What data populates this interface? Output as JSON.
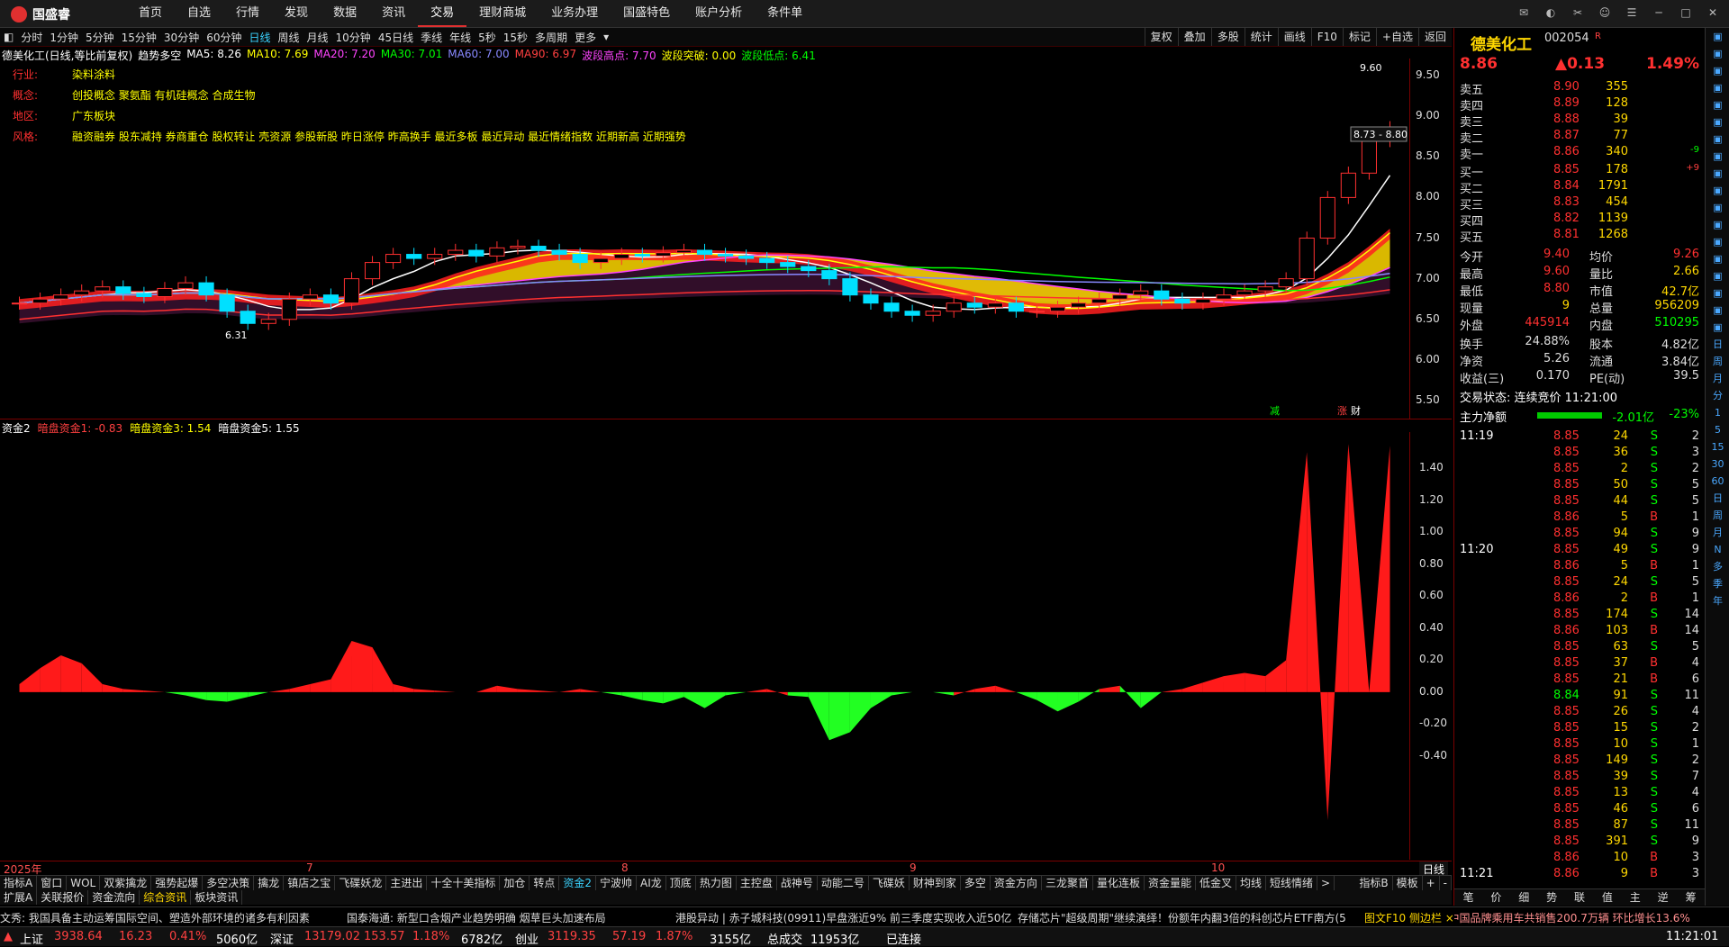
{
  "app": {
    "logo_text": "国盛睿"
  },
  "nav": [
    "首页",
    "自选",
    "行情",
    "发现",
    "数据",
    "资讯",
    "交易",
    "理财商城",
    "业务办理",
    "国盛特色",
    "账户分析",
    "条件单"
  ],
  "nav_active_index": 6,
  "periods": [
    "分时",
    "1分钟",
    "5分钟",
    "15分钟",
    "30分钟",
    "60分钟",
    "日线",
    "周线",
    "月线",
    "10分钟",
    "45日线",
    "季线",
    "年线",
    "5秒",
    "15秒",
    "多周期",
    "更多"
  ],
  "period_selected_index": 6,
  "tools": [
    "复权",
    "叠加",
    "多股",
    "统计",
    "画线",
    "F10",
    "标记",
    "+自选",
    "返回"
  ],
  "chart_header": {
    "title": "德美化工(日线,等比前复权)",
    "indicator": "趋势多空",
    "ma5": "MA5: 8.26",
    "ma10": "MA10: 7.69",
    "ma20": "MA20: 7.20",
    "ma30": "MA30: 7.01",
    "ma60": "MA60: 7.00",
    "ma90": "MA90: 6.97",
    "wave_high": "波段高点: 7.70",
    "wave_break": "波段突破: 0.00",
    "wave_low": "波段低点: 6.41"
  },
  "info": {
    "industry_label": "行业:",
    "industry": "染料涂料",
    "concept_label": "概念:",
    "concept": "创投概念 聚氨酯 有机硅概念 合成生物",
    "region_label": "地区:",
    "region": "广东板块",
    "style_label": "风格:",
    "style": "融资融券 股东减持 券商重仓 股权转让 壳资源 参股新股 昨日涨停 昨高换手 最近多板 最近异动 最近情绪指数 近期新高 近期强势"
  },
  "main_yaxis": [
    "9.50",
    "9.00",
    "8.50",
    "8.00",
    "7.50",
    "7.00",
    "6.50",
    "6.00",
    "5.50"
  ],
  "annotations": {
    "high": "9.60",
    "range": "8.73 - 8.80",
    "low": "6.31",
    "tag_reduce": "减",
    "tag_rise": "涨",
    "tag_fin": "财"
  },
  "sub_header": {
    "name": "资金2",
    "v1": "暗盘资金1: -0.83",
    "v3": "暗盘资金3: 1.54",
    "v5": "暗盘资金5: 1.55"
  },
  "sub_yaxis": [
    "1.40",
    "1.20",
    "1.00",
    "0.80",
    "0.60",
    "0.40",
    "0.20",
    "0.00",
    "-0.20",
    "-0.40"
  ],
  "dates": [
    "2025年",
    "7",
    "8",
    "9",
    "10"
  ],
  "period_label": "日线",
  "indicator_tabs": [
    "指标A",
    "窗口",
    "WOL",
    "双紫擒龙",
    "强势起爆",
    "多空决策",
    "擒龙",
    "镇店之宝",
    "飞碟妖龙",
    "主进出",
    "十全十美指标",
    "加仓",
    "转点",
    "资金2",
    "宁波帅",
    "AI龙",
    "顶底",
    "热力图",
    "主控盘",
    "战神号",
    "动能二号",
    "飞碟妖",
    "财神到家",
    "多空",
    "资金方向",
    "三龙聚首",
    "量化连板",
    "资金量能",
    "低金叉",
    "均线",
    "短线情绪"
  ],
  "indicator_selected": 13,
  "indicator_right": [
    "指标B",
    "模板",
    "+",
    "-"
  ],
  "bottom_tabs": [
    "扩展A",
    "关联报价",
    "资金流向",
    "综合资讯",
    "板块资讯"
  ],
  "bottom_tab_selected": 3,
  "ticker": [
    "文秀: 我国具备主动运筹国际空间、塑造外部环境的诸多有利因素",
    "国泰海通: 新型口含烟产业趋势明确 烟草巨头加速布局",
    "港股异动 | 赤子城科技(09911)早盘涨近9% 前三季度实现收入近50亿",
    "存储芯片\"超级周期\"继续演绎！份额年内翻3倍的科创芯片ETF南方(5",
    "中汽协: 9月中国品牌乘用车共销售200.7万辆 环比增长13.6%"
  ],
  "ticker_right": "图文F10 侧边栏 ×",
  "status": {
    "sh_label": "上证",
    "sh": "3938.64",
    "sh_chg": "16.23",
    "sh_pct": "0.41%",
    "sh_amt": "5060亿",
    "sz_label": "深证",
    "sz": "13179.02",
    "sz_chg": "153.57",
    "sz_pct": "1.18%",
    "sz_amt": "6782亿",
    "cy_label": "创业",
    "cy": "3119.35",
    "cy_chg": "57.19",
    "cy_pct": "1.87%",
    "cy_amt": "3155亿",
    "total_label": "总成交",
    "total": "11953亿",
    "conn": "已连接",
    "time": "11:21:01"
  },
  "quote": {
    "name": "德美化工",
    "code": "002054",
    "flag": "R",
    "price": "8.86",
    "change": "▲0.13",
    "pct": "1.49%",
    "asks": [
      {
        "label": "卖五",
        "price": "8.90",
        "vol": "355",
        "chg": ""
      },
      {
        "label": "卖四",
        "price": "8.89",
        "vol": "128",
        "chg": ""
      },
      {
        "label": "卖三",
        "price": "8.88",
        "vol": "39",
        "chg": ""
      },
      {
        "label": "卖二",
        "price": "8.87",
        "vol": "77",
        "chg": ""
      },
      {
        "label": "卖一",
        "price": "8.86",
        "vol": "340",
        "chg": "-9"
      }
    ],
    "bids": [
      {
        "label": "买一",
        "price": "8.85",
        "vol": "178",
        "chg": "+9"
      },
      {
        "label": "买二",
        "price": "8.84",
        "vol": "1791",
        "chg": ""
      },
      {
        "label": "买三",
        "price": "8.83",
        "vol": "454",
        "chg": ""
      },
      {
        "label": "买四",
        "price": "8.82",
        "vol": "1139",
        "chg": ""
      },
      {
        "label": "买五",
        "price": "8.81",
        "vol": "1268",
        "chg": ""
      }
    ],
    "stats": [
      {
        "l1": "今开",
        "v1": "9.40",
        "l2": "均价",
        "v2": "9.26"
      },
      {
        "l1": "最高",
        "v1": "9.60",
        "l2": "量比",
        "v2": "2.66"
      },
      {
        "l1": "最低",
        "v1": "8.80",
        "l2": "市值",
        "v2": "42.7亿"
      },
      {
        "l1": "现量",
        "v1": "9",
        "l2": "总量",
        "v2": "956209"
      },
      {
        "l1": "外盘",
        "v1": "445914",
        "l2": "内盘",
        "v2": "510295"
      }
    ],
    "stats2": [
      {
        "l1": "换手",
        "v1": "24.88%",
        "l2": "股本",
        "v2": "4.82亿"
      },
      {
        "l1": "净资",
        "v1": "5.26",
        "l2": "流通",
        "v2": "3.84亿"
      },
      {
        "l1": "收益(三)",
        "v1": "0.170",
        "l2": "PE(动)",
        "v2": "39.5"
      }
    ],
    "trade_state": "交易状态: 连续竞价 11:21:00",
    "net_label": "主力净额",
    "net_value": "-2.01亿",
    "net_pct": "-23%"
  },
  "ticks": [
    {
      "t": "11:19",
      "p": "8.85",
      "v": "24",
      "s": "S",
      "n": "2"
    },
    {
      "t": "",
      "p": "8.85",
      "v": "36",
      "s": "S",
      "n": "3"
    },
    {
      "t": "",
      "p": "8.85",
      "v": "2",
      "s": "S",
      "n": "2"
    },
    {
      "t": "",
      "p": "8.85",
      "v": "50",
      "s": "S",
      "n": "5"
    },
    {
      "t": "",
      "p": "8.85",
      "v": "44",
      "s": "S",
      "n": "5"
    },
    {
      "t": "",
      "p": "8.86",
      "v": "5",
      "s": "B",
      "n": "1"
    },
    {
      "t": "",
      "p": "8.85",
      "v": "94",
      "s": "S",
      "n": "9"
    },
    {
      "t": "11:20",
      "p": "8.85",
      "v": "49",
      "s": "S",
      "n": "9"
    },
    {
      "t": "",
      "p": "8.86",
      "v": "5",
      "s": "B",
      "n": "1"
    },
    {
      "t": "",
      "p": "8.85",
      "v": "24",
      "s": "S",
      "n": "5"
    },
    {
      "t": "",
      "p": "8.86",
      "v": "2",
      "s": "B",
      "n": "1"
    },
    {
      "t": "",
      "p": "8.85",
      "v": "174",
      "s": "S",
      "n": "14"
    },
    {
      "t": "",
      "p": "8.86",
      "v": "103",
      "s": "B",
      "n": "14"
    },
    {
      "t": "",
      "p": "8.85",
      "v": "63",
      "s": "S",
      "n": "5"
    },
    {
      "t": "",
      "p": "8.85",
      "v": "37",
      "s": "B",
      "n": "4"
    },
    {
      "t": "",
      "p": "8.85",
      "v": "21",
      "s": "B",
      "n": "6"
    },
    {
      "t": "",
      "p": "8.84",
      "v": "91",
      "s": "S",
      "n": "11"
    },
    {
      "t": "",
      "p": "8.85",
      "v": "26",
      "s": "S",
      "n": "4"
    },
    {
      "t": "",
      "p": "8.85",
      "v": "15",
      "s": "S",
      "n": "2"
    },
    {
      "t": "",
      "p": "8.85",
      "v": "10",
      "s": "S",
      "n": "1"
    },
    {
      "t": "",
      "p": "8.85",
      "v": "149",
      "s": "S",
      "n": "2"
    },
    {
      "t": "",
      "p": "8.85",
      "v": "39",
      "s": "S",
      "n": "7"
    },
    {
      "t": "",
      "p": "8.85",
      "v": "13",
      "s": "S",
      "n": "4"
    },
    {
      "t": "",
      "p": "8.85",
      "v": "46",
      "s": "S",
      "n": "6"
    },
    {
      "t": "",
      "p": "8.85",
      "v": "87",
      "s": "S",
      "n": "11"
    },
    {
      "t": "",
      "p": "8.85",
      "v": "391",
      "s": "S",
      "n": "9"
    },
    {
      "t": "",
      "p": "8.86",
      "v": "10",
      "s": "B",
      "n": "3"
    },
    {
      "t": "11:21",
      "p": "8.86",
      "v": "9",
      "s": "B",
      "n": "3"
    }
  ],
  "panel_tabs": [
    "笔",
    "价",
    "细",
    "势",
    "联",
    "值",
    "主",
    "逆",
    "筹"
  ],
  "sidebar": [
    "日",
    "周",
    "月",
    "分",
    "1",
    "5",
    "15",
    "30",
    "60",
    "日",
    "周",
    "月",
    "N",
    "多",
    "季",
    "年"
  ],
  "chart_data": {
    "type": "candlestick",
    "close": [
      6.7,
      6.75,
      6.8,
      6.85,
      6.9,
      6.82,
      6.78,
      6.88,
      6.95,
      6.8,
      6.6,
      6.45,
      6.5,
      6.75,
      6.8,
      6.7,
      7.0,
      7.2,
      7.3,
      7.25,
      7.3,
      7.35,
      7.28,
      7.38,
      7.4,
      7.35,
      7.3,
      7.2,
      7.25,
      7.3,
      7.28,
      7.32,
      7.35,
      7.3,
      7.28,
      7.25,
      7.2,
      7.15,
      7.1,
      7.0,
      6.8,
      6.7,
      6.6,
      6.55,
      6.6,
      6.7,
      6.65,
      6.7,
      6.6,
      6.6,
      6.65,
      6.7,
      6.75,
      6.8,
      6.85,
      6.75,
      6.7,
      6.75,
      6.8,
      6.85,
      6.9,
      7.0,
      7.5,
      8.0,
      8.3,
      8.7,
      8.86
    ],
    "osc": [
      0.05,
      0.15,
      0.23,
      0.18,
      0.05,
      0.02,
      0.01,
      0.0,
      -0.02,
      -0.05,
      -0.06,
      -0.03,
      0.0,
      0.02,
      0.05,
      0.08,
      0.32,
      0.28,
      0.05,
      0.02,
      0.01,
      0.0,
      0.0,
      0.04,
      0.02,
      0.01,
      0.0,
      0.02,
      0.0,
      -0.02,
      -0.05,
      -0.07,
      -0.03,
      -0.1,
      -0.02,
      0.0,
      0.02,
      -0.02,
      -0.03,
      -0.3,
      -0.25,
      -0.1,
      -0.02,
      0.0,
      0.0,
      -0.02,
      0.02,
      0.04,
      0.0,
      -0.05,
      -0.12,
      -0.06,
      0.02,
      0.04,
      -0.1,
      0.0,
      0.02,
      0.06,
      0.1,
      0.12,
      0.1,
      0.2,
      1.5,
      -0.8,
      1.55,
      0.0,
      1.54
    ],
    "ylim_main": [
      5.5,
      9.6
    ],
    "ylim_sub": [
      -0.4,
      1.4
    ]
  }
}
